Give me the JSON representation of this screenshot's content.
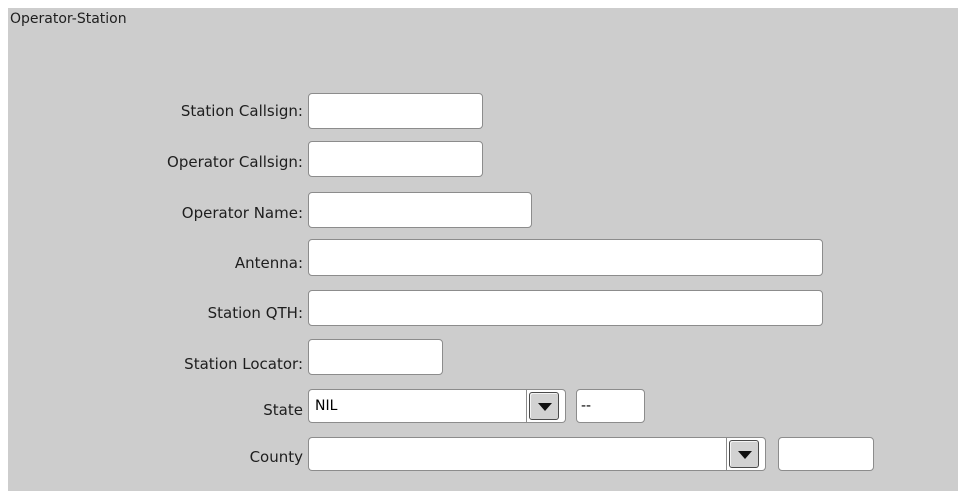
{
  "panel": {
    "title": "Operator-Station"
  },
  "form": {
    "station_callsign": {
      "label": "Station Callsign:",
      "value": ""
    },
    "operator_callsign": {
      "label": "Operator Callsign:",
      "value": ""
    },
    "operator_name": {
      "label": "Operator Name:",
      "value": ""
    },
    "antenna": {
      "label": "Antenna:",
      "value": ""
    },
    "station_qth": {
      "label": "Station QTH:",
      "value": ""
    },
    "station_locator": {
      "label": "Station Locator:",
      "value": ""
    },
    "state": {
      "label": "State",
      "selected": "NIL",
      "code": "--"
    },
    "county": {
      "label": "County",
      "selected": "",
      "code": ""
    }
  },
  "icons": {
    "dropdown": "chevron-down-icon"
  }
}
